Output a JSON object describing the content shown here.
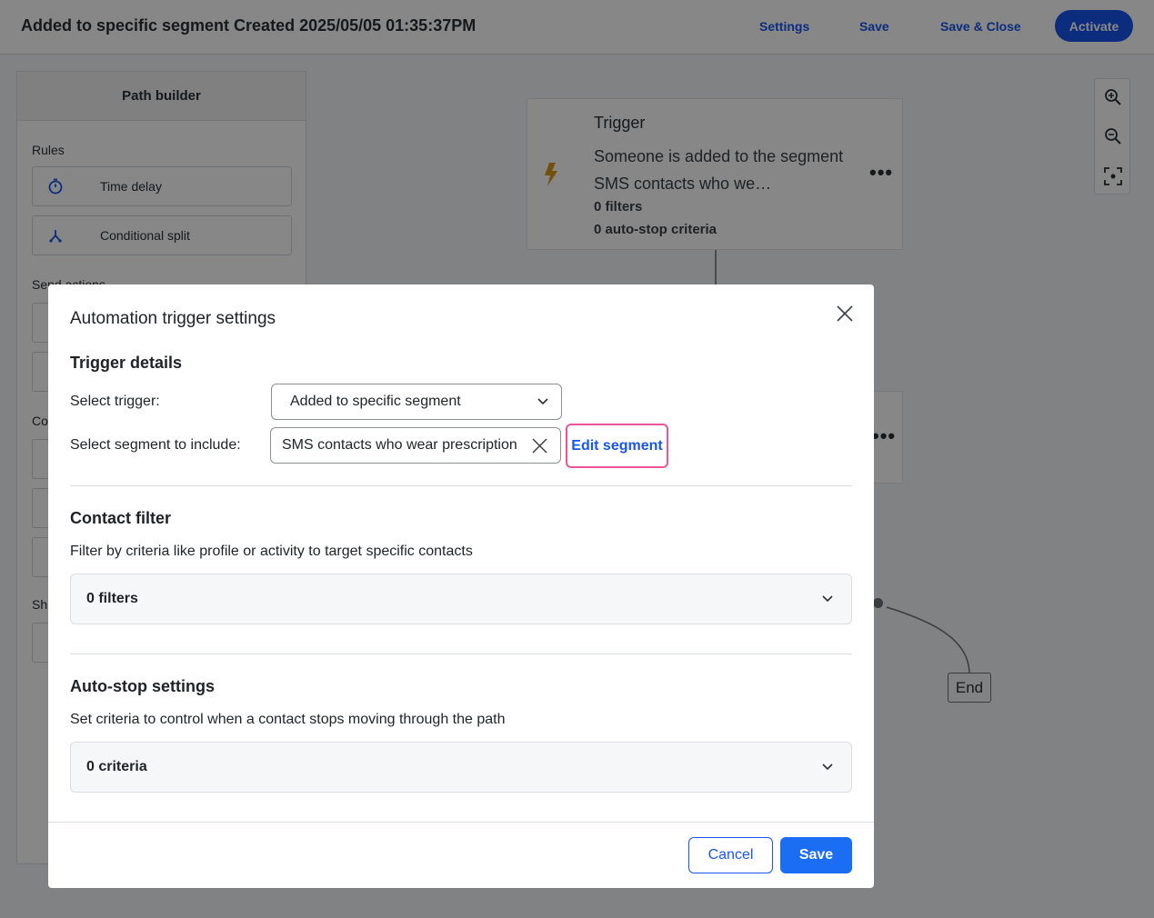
{
  "header": {
    "title": "Added to specific segment Created 2025/05/05 01:35:37PM",
    "settings_label": "Settings",
    "save_label": "Save",
    "save_close_label": "Save & Close",
    "activate_label": "Activate"
  },
  "path_builder": {
    "title": "Path builder",
    "rules_label": "Rules",
    "rules": [
      {
        "label": "Time delay",
        "icon": "stopwatch-icon"
      },
      {
        "label": "Conditional split",
        "icon": "split-icon"
      }
    ],
    "send_actions_label": "Send actions",
    "partial_labels": [
      "Co",
      "Sh"
    ]
  },
  "canvas": {
    "trigger": {
      "title": "Trigger",
      "description": "Someone is added to the segment SMS contacts who we…",
      "filters": "0 filters",
      "autostop": "0 auto-stop criteria",
      "more_label": "•••"
    },
    "end_label": "End"
  },
  "modal": {
    "title": "Automation trigger settings",
    "trigger_details": {
      "heading": "Trigger details",
      "select_trigger_label": "Select trigger:",
      "select_trigger_value": "Added to specific segment",
      "segment_label": "Select segment to include:",
      "segment_value": "SMS contacts who wear prescription",
      "edit_segment_label": "Edit segment"
    },
    "contact_filter": {
      "heading": "Contact filter",
      "description": "Filter by criteria like profile or activity to target specific contacts",
      "value": "0 filters"
    },
    "auto_stop": {
      "heading": "Auto-stop settings",
      "description": "Set criteria to control when a contact stops moving through the path",
      "value": "0 criteria"
    },
    "cancel_label": "Cancel",
    "save_label": "Save"
  },
  "colors": {
    "accent": "#1856ed",
    "highlight": "#e8559a",
    "trigger_icon": "#d69a17"
  }
}
